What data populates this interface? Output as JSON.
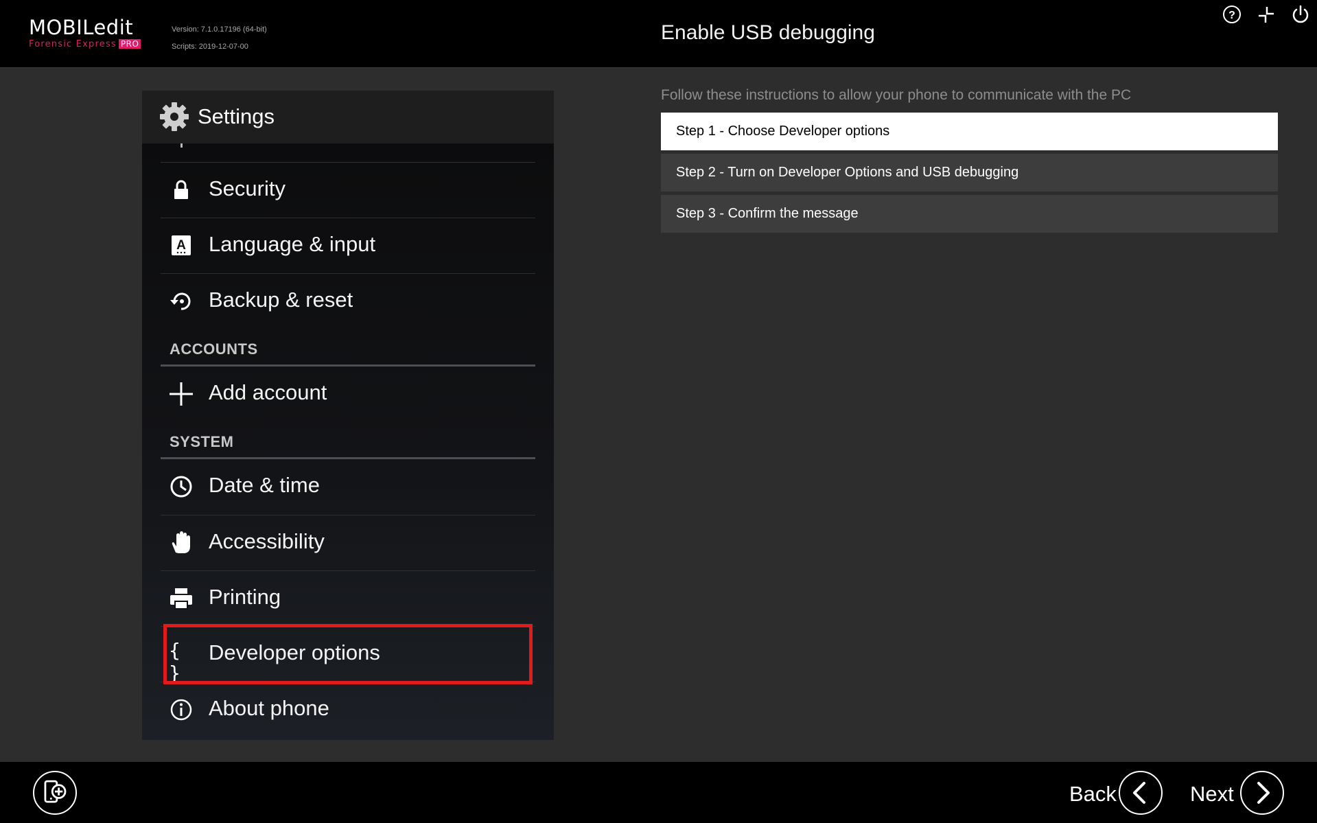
{
  "header": {
    "logo_main": "MOBILedit",
    "logo_sub": "Forensic Express",
    "logo_pro": "PRO",
    "version": "Version: 7.1.0.17196 (64-bit)",
    "scripts": "Scripts: 2019-12-07-00",
    "title": "Enable USB debugging",
    "icons": [
      "help-icon",
      "collapse-icon",
      "power-icon"
    ]
  },
  "phone": {
    "title": "Settings",
    "rows": [
      {
        "label": "Security",
        "icon": "lock-icon"
      },
      {
        "label": "Language & input",
        "icon": "keyboard-a-icon"
      },
      {
        "label": "Backup & reset",
        "icon": "backup-icon"
      },
      {
        "label": "Add account",
        "icon": "plus-icon"
      },
      {
        "label": "Date & time",
        "icon": "clock-icon"
      },
      {
        "label": "Accessibility",
        "icon": "hand-icon"
      },
      {
        "label": "Printing",
        "icon": "printer-icon"
      },
      {
        "label": "Developer options",
        "icon": "braces-icon"
      },
      {
        "label": "About phone",
        "icon": "info-icon"
      }
    ],
    "sections": [
      "ACCOUNTS",
      "SYSTEM"
    ]
  },
  "main": {
    "instructions": "Follow these instructions to allow your phone to communicate with the PC",
    "steps": [
      {
        "label": "Step 1 - Choose Developer options",
        "active": true
      },
      {
        "label": "Step 2 - Turn on Developer Options and USB debugging",
        "active": false
      },
      {
        "label": "Step 3 - Confirm the message",
        "active": false
      }
    ]
  },
  "footer": {
    "back_label": "Back",
    "next_label": "Next"
  },
  "colors": {
    "accent": "#e5196a",
    "highlight": "#e11b1b",
    "background": "#2d2d2d"
  }
}
